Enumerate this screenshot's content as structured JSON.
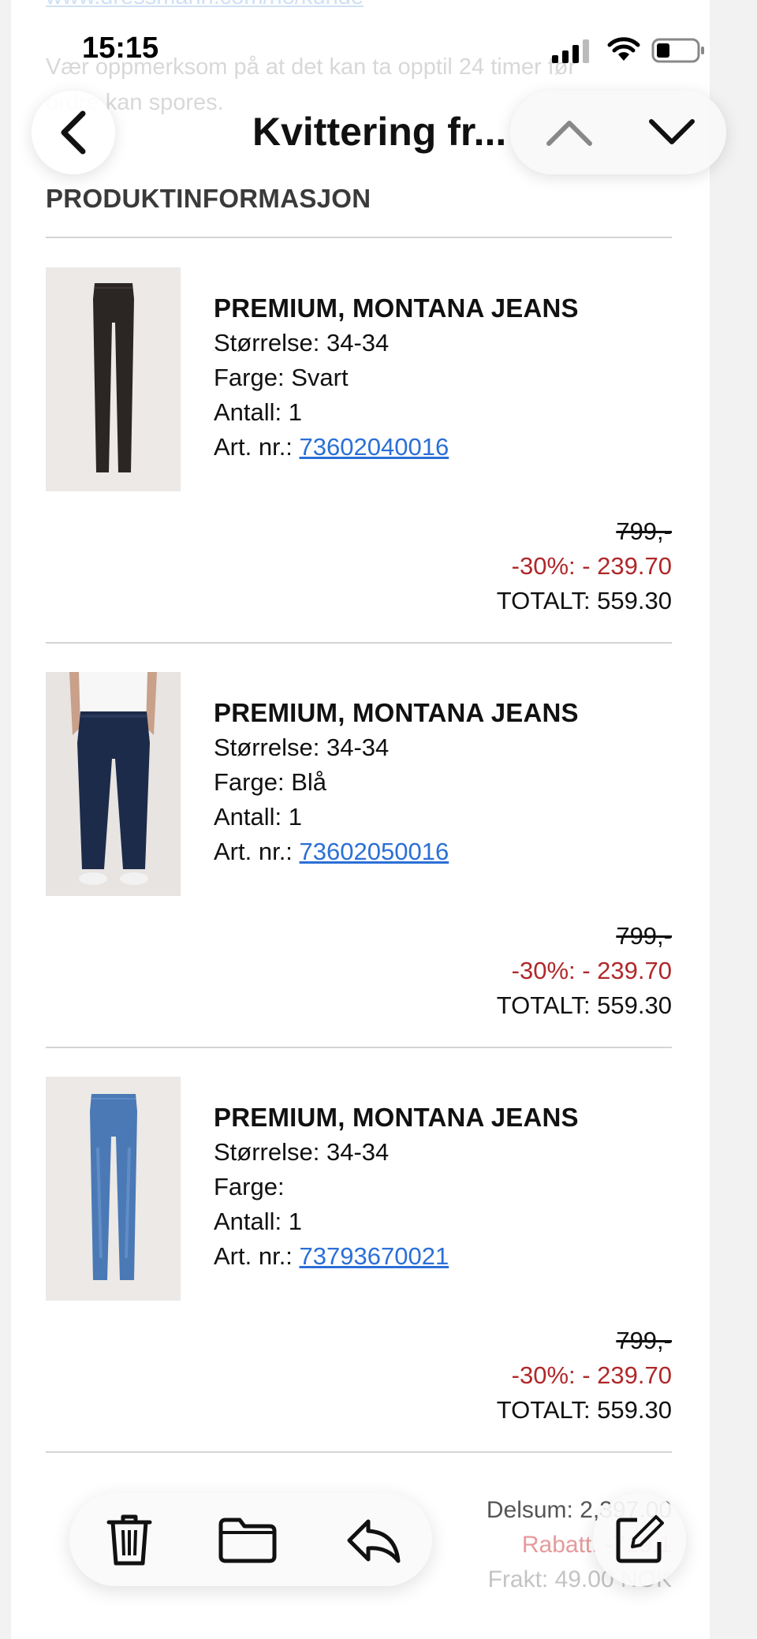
{
  "status_bar": {
    "time": "15:15"
  },
  "nav": {
    "title": "Kvittering fr..."
  },
  "faded_text": {
    "link_fragment": "www.dressmann.com/no/kunde",
    "line1": "Vær oppmerksom på at det kan ta opptil 24 timer før",
    "line2": "ordre kan spores."
  },
  "section_title": "PRODUKTINFORMASJON",
  "products": [
    {
      "name": "PREMIUM, MONTANA JEANS",
      "size": "Størrelse: 34-34",
      "color": "Farge: Svart",
      "qty": "Antall: 1",
      "art_label": "Art. nr.: ",
      "art_no": "73602040016",
      "orig_price": "799,-",
      "discount": "-30%: - 239.70",
      "total": "TOTALT: 559.30",
      "image": "black-jeans"
    },
    {
      "name": "PREMIUM, MONTANA JEANS",
      "size": "Størrelse: 34-34",
      "color": "Farge: Blå",
      "qty": "Antall: 1",
      "art_label": "Art. nr.: ",
      "art_no": "73602050016",
      "orig_price": "799,-",
      "discount": "-30%: - 239.70",
      "total": "TOTALT: 559.30",
      "image": "dark-blue-jeans-model"
    },
    {
      "name": "PREMIUM, MONTANA JEANS",
      "size": "Størrelse: 34-34",
      "color": "Farge:",
      "qty": "Antall: 1",
      "art_label": "Art. nr.: ",
      "art_no": "73793670021",
      "orig_price": "799,-",
      "discount": "-30%: - 239.70",
      "total": "TOTALT: 559.30",
      "image": "light-blue-jeans"
    }
  ],
  "summary": {
    "subtotal": "Delsum: 2,397.00",
    "discount": "Rabatt: -719.1",
    "shipping": "Frakt: 49.00 NOK"
  },
  "toolbar": {
    "icons": [
      "trash-icon",
      "folder-icon",
      "reply-icon",
      "compose-icon"
    ]
  },
  "colors": {
    "link": "#2b6fd6",
    "discount": "#b0282a"
  }
}
